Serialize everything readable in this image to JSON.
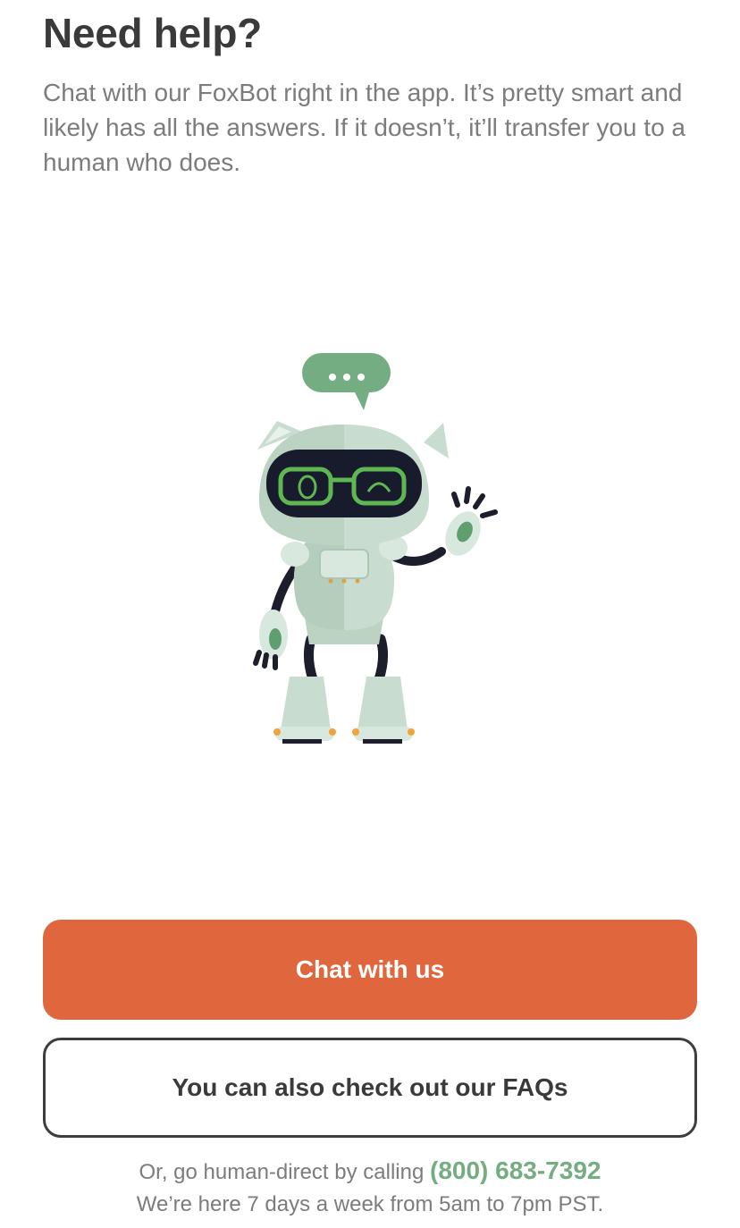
{
  "header": {
    "title": "Need help?"
  },
  "intro": {
    "text": "Chat with our FoxBot right in the app. It’s pretty smart and likely has all the answers. If it doesn’t, it’ll transfer you to a human who does."
  },
  "illustration": {
    "icon": "foxbot-robot-waving",
    "bubble_icon": "chat-bubble-icon"
  },
  "actions": {
    "chat_label": "Chat with us",
    "faq_label": "You can also check out our FAQs"
  },
  "footer": {
    "call_prefix": "Or, go human-direct by calling",
    "phone": "(800) 683-7392",
    "hours": "We’re here 7 days a week from 5am to 7pm PST."
  },
  "colors": {
    "primary_button": "#e0663e",
    "accent_green": "#75ad82",
    "heading": "#3a3a3a",
    "body_text": "#7c7c7c"
  }
}
